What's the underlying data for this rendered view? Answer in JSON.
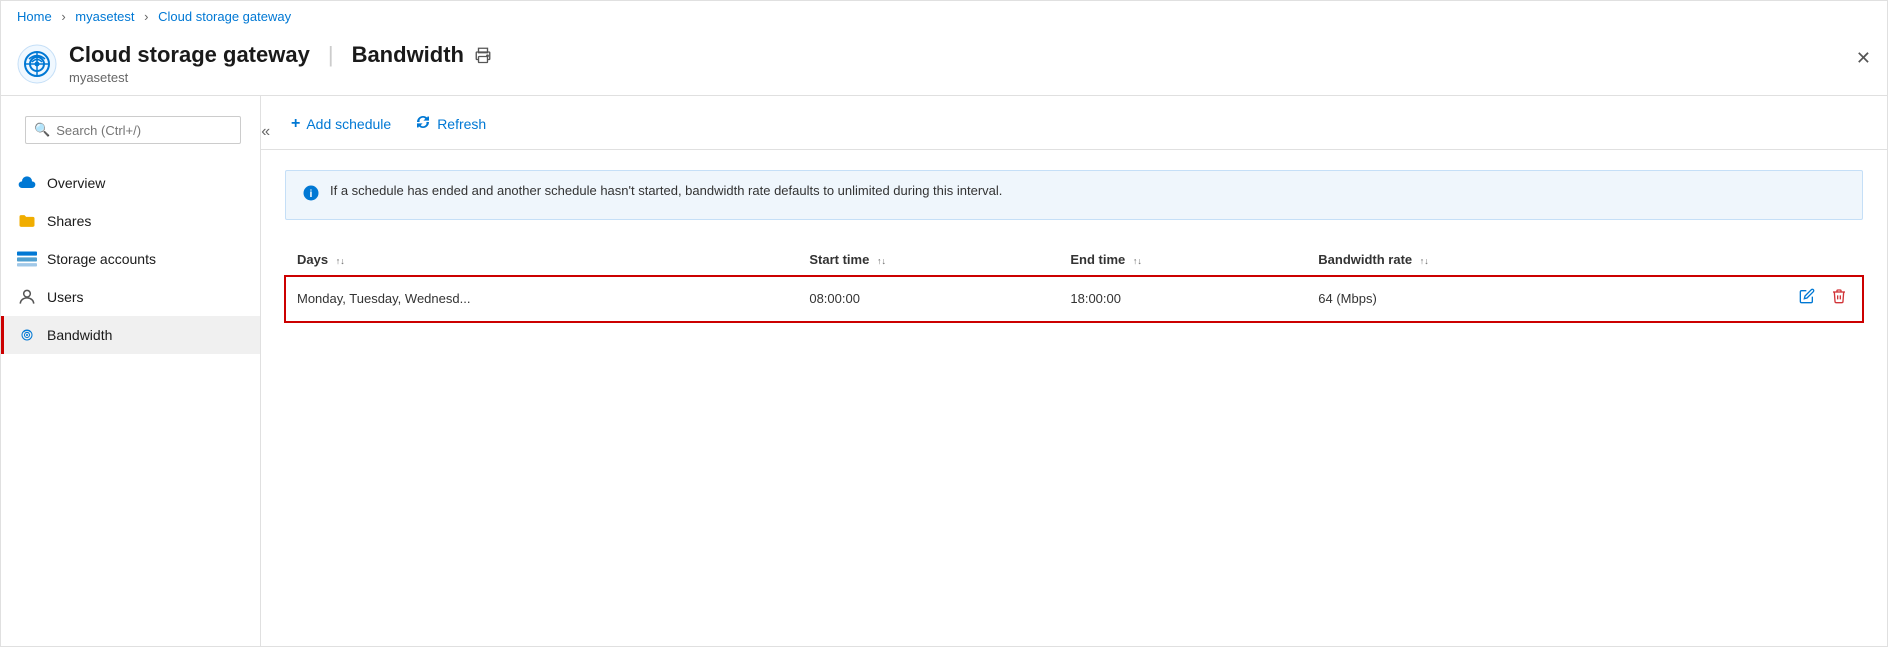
{
  "breadcrumb": {
    "home": "Home",
    "resource": "myasetest",
    "current": "Cloud storage gateway"
  },
  "header": {
    "title": "Cloud storage gateway",
    "separator": "|",
    "page": "Bandwidth",
    "subtitle": "myasetest"
  },
  "search": {
    "placeholder": "Search (Ctrl+/)"
  },
  "sidebar": {
    "collapse_tooltip": "«",
    "items": [
      {
        "id": "overview",
        "label": "Overview",
        "icon": "cloud-icon"
      },
      {
        "id": "shares",
        "label": "Shares",
        "icon": "folder-icon"
      },
      {
        "id": "storage-accounts",
        "label": "Storage accounts",
        "icon": "storage-icon"
      },
      {
        "id": "users",
        "label": "Users",
        "icon": "user-icon"
      },
      {
        "id": "bandwidth",
        "label": "Bandwidth",
        "icon": "bandwidth-icon",
        "active": true
      }
    ]
  },
  "toolbar": {
    "add_schedule": "Add schedule",
    "refresh": "Refresh"
  },
  "info_banner": {
    "message": "If a schedule has ended and another schedule hasn't started, bandwidth rate defaults to unlimited during this interval."
  },
  "table": {
    "columns": [
      {
        "key": "days",
        "label": "Days"
      },
      {
        "key": "start_time",
        "label": "Start time"
      },
      {
        "key": "end_time",
        "label": "End time"
      },
      {
        "key": "bandwidth_rate",
        "label": "Bandwidth rate"
      }
    ],
    "rows": [
      {
        "days": "Monday, Tuesday, Wednesd...",
        "start_time": "08:00:00",
        "end_time": "18:00:00",
        "bandwidth_rate": "64 (Mbps)",
        "highlighted": true
      }
    ]
  }
}
